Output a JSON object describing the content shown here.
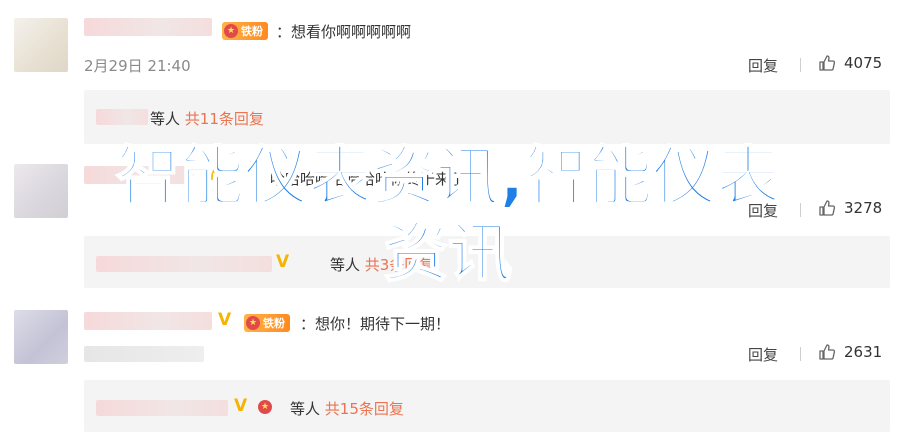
{
  "comments": [
    {
      "vip_label": "铁粉",
      "text": "：想看你啊啊啊啊啊",
      "date": "2月29日 21:40",
      "reply_label": "回复",
      "likes": "4075",
      "sub": {
        "who": "等人",
        "count": "共11条回复"
      }
    },
    {
      "vip_label": "",
      "text": "哈哈哈哈哈哈哈哈你终于来了",
      "reply_label": "回复",
      "likes": "3278",
      "sub": {
        "who": "等人",
        "count": "共3条回复"
      }
    },
    {
      "vip_label": "铁粉",
      "text": "：想你！期待下一期！",
      "reply_label": "回复",
      "likes": "2631",
      "sub": {
        "who": "等人",
        "count": "共15条回复"
      }
    }
  ],
  "watermark": {
    "line1": "智能仪表资讯,智能仪表",
    "line2": "资讯"
  },
  "colors": {
    "accent_orange": "#eb7350",
    "watermark_blue": "#1f7fe4"
  }
}
